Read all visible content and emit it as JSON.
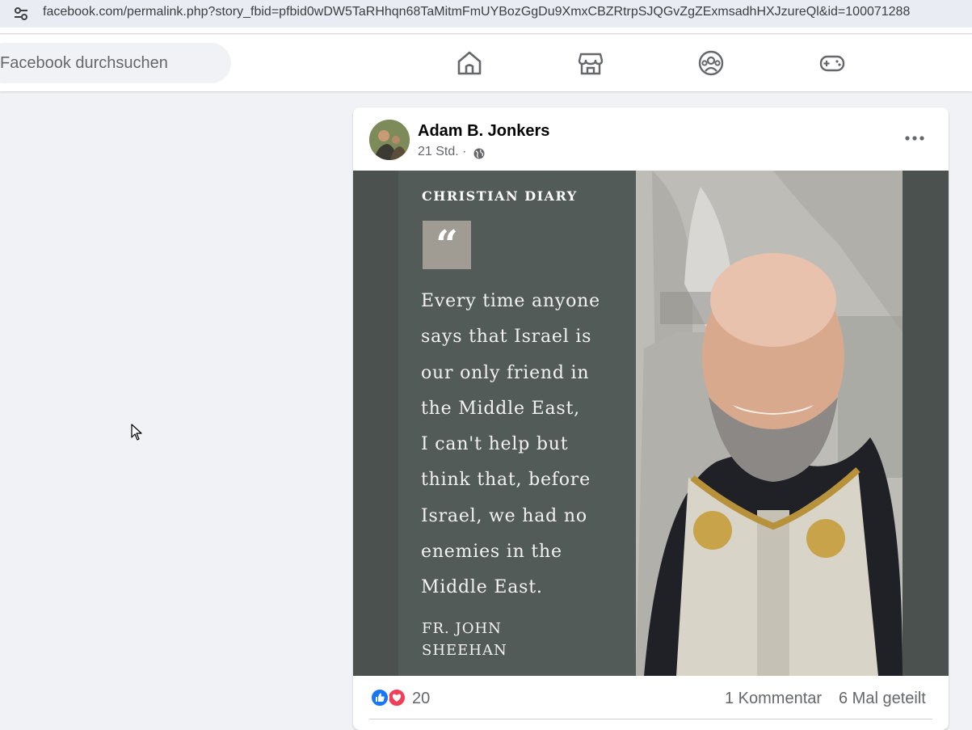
{
  "browser": {
    "url": "facebook.com/permalink.php?story_fbid=pfbid0wDW5TaRHhqn68TaMitmFmUYBozGgDu9XmxCBZRtrpSJQGvZgZExmsadhHXJzureQl&id=100071288"
  },
  "nav": {
    "search_placeholder": "Facebook durchsuchen",
    "icons": [
      "home-icon",
      "marketplace-icon",
      "groups-icon",
      "gaming-icon"
    ]
  },
  "post": {
    "author": "Adam B. Jonkers",
    "time": "21 Std. ·",
    "image": {
      "brand": "CHRISTIAN DIARY",
      "quote_lines": [
        "Every time anyone",
        "says that Israel is",
        "our only friend in",
        "the Middle East,",
        "I can't help but",
        "think that, before",
        "Israel, we had no",
        "enemies in the",
        "Middle East."
      ],
      "attribution_lines": [
        "FR. JOHN",
        "SHEEHAN"
      ]
    },
    "reaction_count": "20",
    "comments": "1 Kommentar",
    "shares": "6 Mal geteilt"
  },
  "colors": {
    "fb_blue": "#1877f2",
    "love_red": "#f33e58",
    "image_bg": "#4a514f",
    "quote_box": "#a09b93"
  }
}
